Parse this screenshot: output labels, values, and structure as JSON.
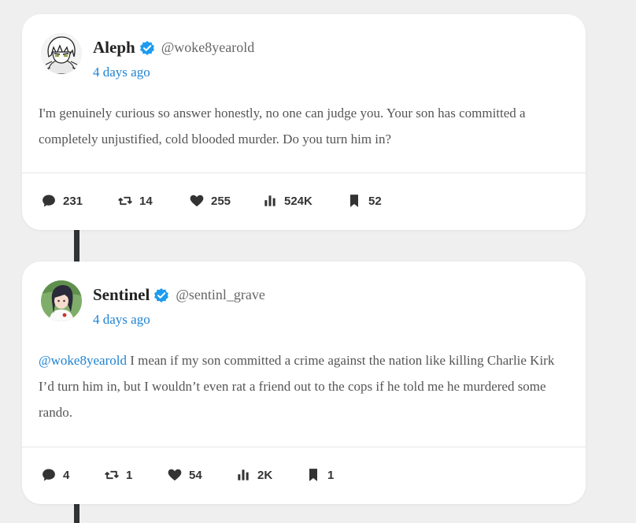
{
  "posts": [
    {
      "name": "Aleph",
      "handle": "@woke8yearold",
      "time": "4 days ago",
      "mention": "",
      "text": "I'm genuinely curious so answer honestly, no one can judge you. Your son has committed a completely unjustified, cold blooded murder. Do you turn him in?",
      "stats": {
        "replies": "231",
        "reposts": "14",
        "likes": "255",
        "views": "524K",
        "bookmarks": "52"
      }
    },
    {
      "name": "Sentinel",
      "handle": "@sentinl_grave",
      "time": "4 days ago",
      "mention": "@woke8yearold",
      "text": " I mean if my son committed a crime against the nation like killing Charlie Kirk I’d turn him in, but I wouldn’t even rat a friend out to the cops if he told me he murdered some rando.",
      "stats": {
        "replies": "4",
        "reposts": "1",
        "likes": "54",
        "views": "2K",
        "bookmarks": "1"
      }
    }
  ],
  "colors": {
    "accent": "#1d83d4",
    "verified": "#1d9bf0",
    "thread_line": "#2f3336"
  },
  "icons": [
    "comment-icon",
    "repost-icon",
    "heart-icon",
    "views-icon",
    "bookmark-icon",
    "verified-badge-icon"
  ]
}
